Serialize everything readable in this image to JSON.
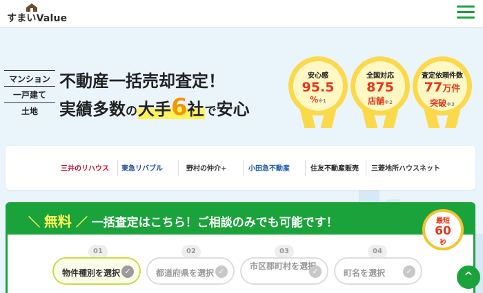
{
  "header": {
    "logo_text": "すまいValue",
    "menu_icon": "hamburger-menu-icon",
    "brand_color": "#1aa33a"
  },
  "hero": {
    "property_tags": [
      "マンション",
      "一戸建て",
      "土地"
    ],
    "headline_line1": "不動産一括売却査定！",
    "headline_line2": {
      "part1": "実績多数",
      "part2": "の",
      "part3": "大手",
      "number": "6",
      "part4": "社",
      "part5": "で",
      "part6": "安心"
    },
    "badges": [
      {
        "label": "安心感",
        "value": "95.5",
        "unit": "%",
        "note": "※1"
      },
      {
        "label": "全国対応",
        "value": "875",
        "unit": "店舗",
        "note": "※2"
      },
      {
        "label": "査定依頼件数",
        "value": "77",
        "value_unit": "万件",
        "unit": "突破",
        "note": "※3"
      }
    ]
  },
  "companies": [
    {
      "name": "三井のリハウス",
      "color": "#c8102e"
    },
    {
      "name": "東急リバブル",
      "color": "#1f4e9c"
    },
    {
      "name": "野村の仲介+",
      "color": "#333333"
    },
    {
      "name": "小田急不動産",
      "color": "#1f5ea8"
    },
    {
      "name": "住友不動産販売",
      "color": "#222222"
    },
    {
      "name": "三菱地所ハウスネット",
      "color": "#333333"
    }
  ],
  "assessment": {
    "free_label": "無料",
    "title": "一括査定はこちら！ご相談のみでも可能です！",
    "fast_badge": {
      "line1": "最短",
      "line2": "60",
      "line3": "秒"
    },
    "steps": [
      {
        "num": "01",
        "label": "物件種別を選択",
        "active": true
      },
      {
        "num": "02",
        "label": "都道府県を選択",
        "active": false
      },
      {
        "num": "03",
        "label": "市区郡町村を選択",
        "active": false
      },
      {
        "num": "04",
        "label": "町名を選択",
        "active": false
      }
    ]
  },
  "scroll_top_icon": "chevron-up-icon"
}
